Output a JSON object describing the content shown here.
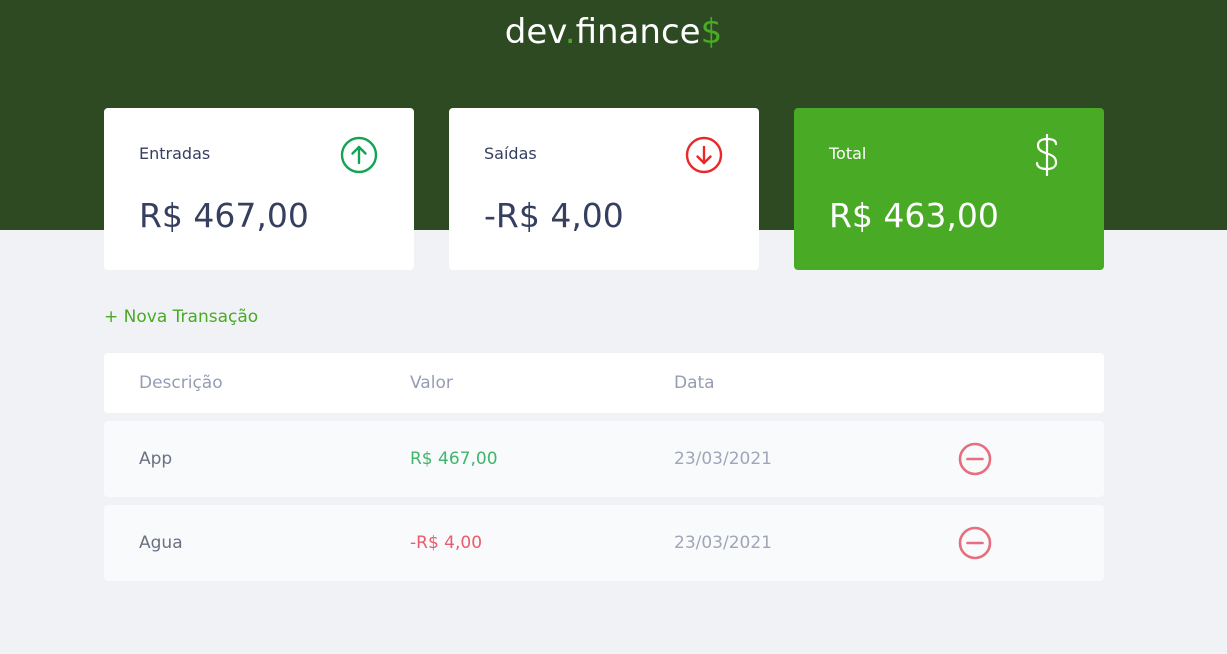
{
  "header": {
    "logo_part1": "dev",
    "logo_dot": ".",
    "logo_part2": "finance",
    "logo_sign": "$"
  },
  "cards": {
    "income": {
      "label": "Entradas",
      "amount": "R$ 467,00",
      "icon": "arrow-up-circle-icon",
      "icon_color": "#12a454"
    },
    "expense": {
      "label": "Saídas",
      "amount": "-R$ 4,00",
      "icon": "arrow-down-circle-icon",
      "icon_color": "#e92929"
    },
    "total": {
      "label": "Total",
      "amount": "R$ 463,00",
      "icon": "dollar-sign-icon",
      "background": "#49aa26"
    }
  },
  "new_transaction_label": "+ Nova Transação",
  "table": {
    "headers": [
      "Descrição",
      "Valor",
      "Data"
    ],
    "rows": [
      {
        "description": "App",
        "amount": "R$ 467,00",
        "type": "income",
        "date": "23/03/2021"
      },
      {
        "description": "Agua",
        "amount": "-R$ 4,00",
        "type": "expense",
        "date": "23/03/2021"
      }
    ]
  },
  "colors": {
    "header_bg": "#2d4a22",
    "accent": "#49aa26",
    "page_bg": "#f0f2f5",
    "income": "#3fb66c",
    "expense": "#e85c6e",
    "remove_icon": "#e56f7f"
  }
}
